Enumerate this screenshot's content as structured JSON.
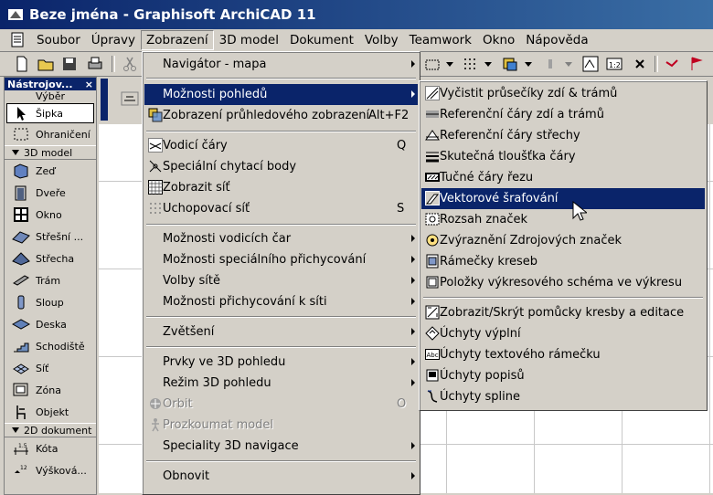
{
  "window": {
    "title": "Beze jména - Graphisoft ArchiCAD 11"
  },
  "menubar": {
    "items": [
      "Soubor",
      "Úpravy",
      "Zobrazení",
      "3D model",
      "Dokument",
      "Volby",
      "Teamwork",
      "Okno",
      "Nápověda"
    ],
    "active": "Zobrazení"
  },
  "toolbox": {
    "title": "Nástrojov...",
    "close": "×",
    "select_label": "Výběr",
    "tools_top": [
      "Šipka",
      "Ohraničení"
    ],
    "category_3d": "3D model",
    "tools_3d": [
      "Zeď",
      "Dveře",
      "Okno",
      "Střešní ...",
      "Střecha",
      "Trám",
      "Sloup",
      "Deska",
      "Schodiště",
      "Síť",
      "Zóna",
      "Objekt"
    ],
    "category_2d": "2D dokument",
    "tools_2d": [
      "Kóta",
      "Výšková..."
    ]
  },
  "view_menu": {
    "navigator": "Navigátor - mapa",
    "view_options": "Možnosti pohledů",
    "transparent_view": "Zobrazení průhledového zobrazení",
    "transparent_view_shortcut": "Alt+F2",
    "guide_lines": "Vodicí čáry",
    "guide_lines_shortcut": "Q",
    "special_snap": "Speciální chytací body",
    "show_grid": "Zobrazit síť",
    "snap_grid": "Uchopovací síť",
    "snap_grid_shortcut": "S",
    "guide_options": "Možnosti vodicích čar",
    "special_snap_options": "Možnosti speciálního přichycování",
    "grid_options": "Volby sítě",
    "snap_grid_options": "Možnosti přichycování k síti",
    "zoom": "Zvětšení",
    "elements_3d": "Prvky ve 3D pohledu",
    "mode_3d": "Režim 3D pohledu",
    "orbit": "Orbit",
    "orbit_shortcut": "O",
    "explore_model": "Prozkoumat model",
    "nav_3d": "Speciality 3D navigace",
    "refresh": "Obnovit"
  },
  "submenu": {
    "items": [
      "Vyčistit průsečíky zdí & trámů",
      "Referenční čáry zdí a trámů",
      "Referenční čáry střechy",
      "Skutečná tloušťka čáry",
      "Tučné čáry řezu",
      "Vektorové šrafování",
      "Rozsah značek",
      "Zvýraznění Zdrojových značek",
      "Rámečky kreseb",
      "Položky výkresového schéma ve výkresu",
      "Zobrazit/Skrýt pomůcky kresby a editace",
      "Úchyty výplní",
      "Úchyty textového rámečku",
      "Úchyty popisů",
      "Úchyty spline"
    ],
    "highlighted": "Vektorové šrafování"
  }
}
